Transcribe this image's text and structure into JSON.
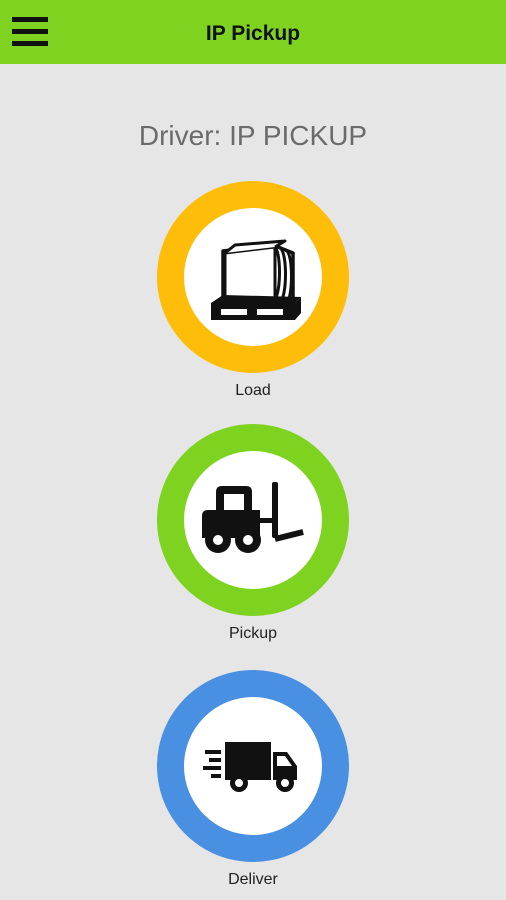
{
  "app_bar": {
    "title": "IP Pickup",
    "menu_icon": "hamburger-menu-icon",
    "color": "#7ed321"
  },
  "driver": {
    "label": "Driver: IP PICKUP"
  },
  "actions": [
    {
      "label": "Load",
      "icon": "pallet-icon",
      "ring_color": "#fdbd08"
    },
    {
      "label": "Pickup",
      "icon": "forklift-icon",
      "ring_color": "#7ed321"
    },
    {
      "label": "Deliver",
      "icon": "delivery-truck-icon",
      "ring_color": "#4a90e2"
    }
  ]
}
